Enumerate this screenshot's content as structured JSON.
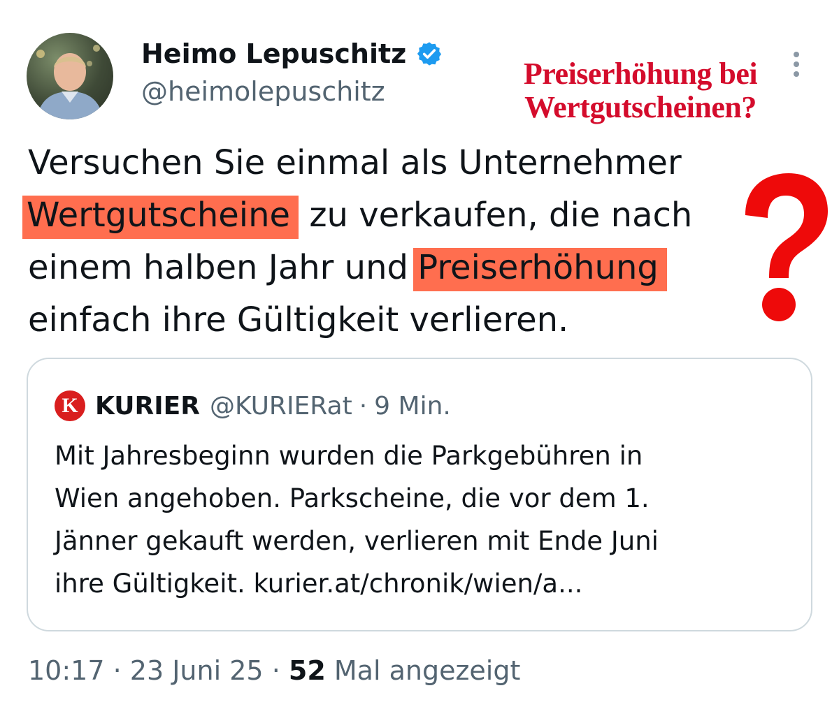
{
  "author": {
    "display_name": "Heimo Lepuschitz",
    "handle": "@heimolepuschitz",
    "verified_icon": "verified-badge-icon"
  },
  "annotation": {
    "title_line1": "Preiserhöhung bei",
    "title_line2": "Wertgutscheinen?",
    "color": "#d40c2c"
  },
  "tweet": {
    "line1": "Versuchen Sie einmal als Unternehmer",
    "line2_highlight": "Wertgutscheine",
    "line2_rest": " zu verkaufen, die nach",
    "line3_start": "einem halben Jahr und ",
    "line3_highlight": "Preiserhöhung",
    "line4": "einfach ihre Gültigkeit verlieren.",
    "highlight_color": "#ff6e4f"
  },
  "quote": {
    "logo_letter": "K",
    "name": "KURIER",
    "handle": "@KURIERat",
    "separator": "·",
    "time": "9 Min.",
    "lines": [
      "Mit Jahresbeginn wurden die Parkgebühren in",
      "Wien angehoben. Parkscheine, die vor dem 1.",
      "Jänner gekauft werden, verlieren mit Ende Juni",
      "ihre Gültigkeit. kurier.at/chronik/wien/a..."
    ]
  },
  "footer": {
    "time": "10:17",
    "separator": "·",
    "date": "23 Juni 25",
    "views_count": "52",
    "views_label": "Mal angezeigt"
  }
}
